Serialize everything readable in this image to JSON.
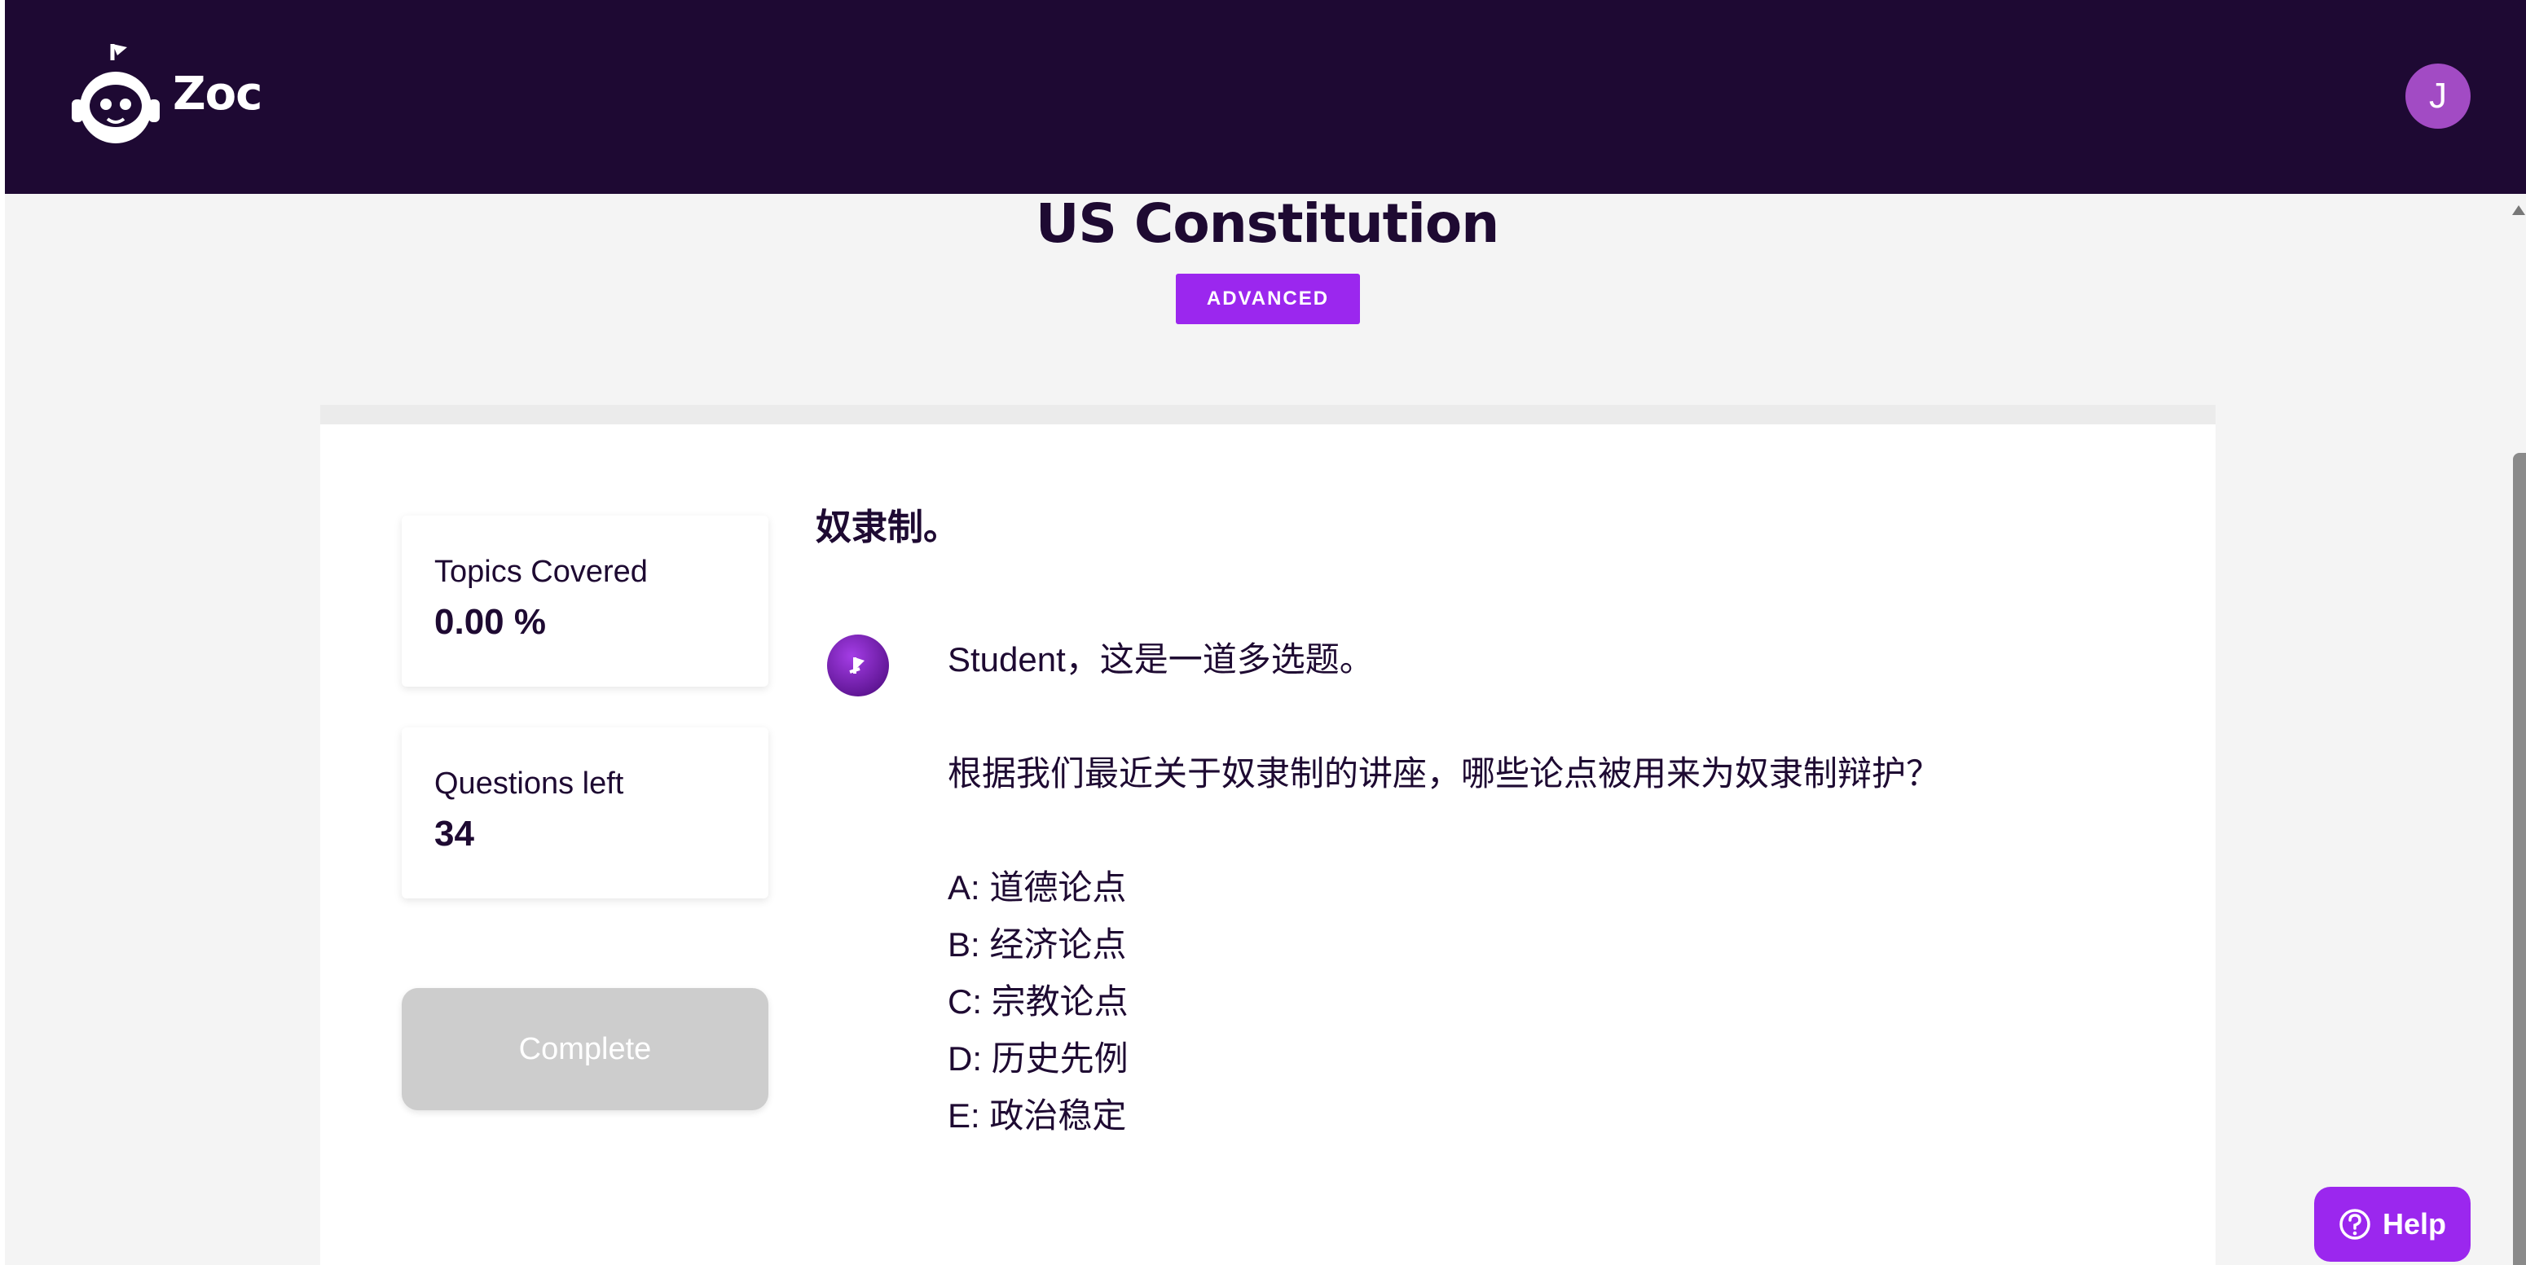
{
  "header": {
    "brand": "Zoc",
    "user_initial": "J"
  },
  "course": {
    "title": "US Constitution",
    "level": "ADVANCED"
  },
  "stats": {
    "topics_label": "Topics Covered",
    "topics_value": "0.00 %",
    "questions_label": "Questions left",
    "questions_value": "34"
  },
  "complete_label": "Complete",
  "question": {
    "title": "奴隶制。",
    "intro": "Student，这是一道多选题。",
    "prompt": "根据我们最近关于奴隶制的讲座，哪些论点被用来为奴隶制辩护？",
    "options": [
      "A: 道德论点",
      "B: 经济论点",
      "C: 宗教论点",
      "D: 历史先例",
      "E: 政治稳定"
    ]
  },
  "help_label": "Help",
  "icons": {
    "logo": "robot-logo-icon",
    "bot": "bot-avatar-icon",
    "help": "question-circle-icon"
  },
  "colors": {
    "header_bg": "#1e0933",
    "accent": "#9b27ee",
    "avatar": "#a24bc4",
    "complete_disabled": "#cdcdcd"
  }
}
